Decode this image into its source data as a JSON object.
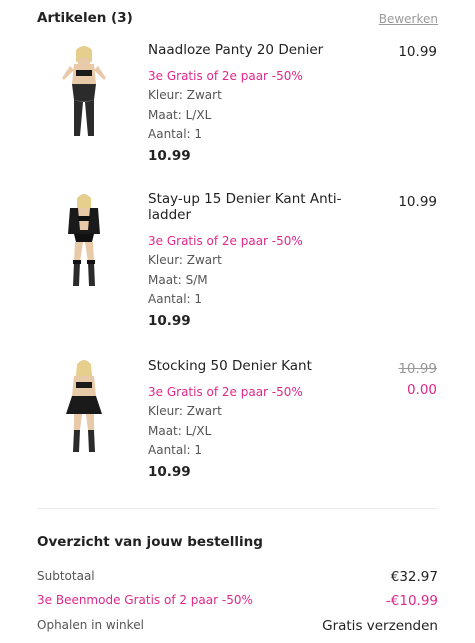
{
  "header": {
    "title": "Artikelen (3)",
    "edit_label": "Bewerken"
  },
  "items": [
    {
      "name": "Naadloze Panty 20 Denier",
      "promo": "3e Gratis of 2e paar -50%",
      "color": "Kleur: Zwart",
      "size": "Maat: L/XL",
      "qty": "Aantal: 1",
      "total": "10.99",
      "price": "10.99"
    },
    {
      "name": "Stay-up 15 Denier Kant Anti-ladder",
      "promo": "3e Gratis of 2e paar -50%",
      "color": "Kleur: Zwart",
      "size": "Maat: S/M",
      "qty": "Aantal: 1",
      "total": "10.99",
      "price": "10.99"
    },
    {
      "name": "Stocking 50 Denier Kant",
      "promo": "3e Gratis of 2e paar -50%",
      "color": "Kleur: Zwart",
      "size": "Maat: L/XL",
      "qty": "Aantal: 1",
      "total": "10.99",
      "price_old": "10.99",
      "price_new": "0.00"
    }
  ],
  "summary": {
    "title": "Overzicht van jouw bestelling",
    "rows": [
      {
        "label": "Subtotaal",
        "value": "€32.97"
      },
      {
        "label": "3e Beenmode Gratis of 2 paar -50%",
        "value": "-€10.99"
      },
      {
        "label": "Ophalen in winkel",
        "value": "Gratis verzenden"
      }
    ]
  },
  "colors": {
    "accent": "#e0288a",
    "text": "#222222",
    "muted": "#999999"
  }
}
